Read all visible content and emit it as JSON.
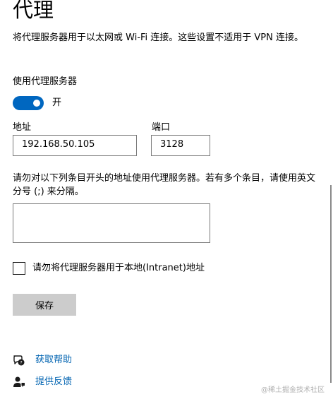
{
  "page": {
    "title": "代理",
    "description": "将代理服务器用于以太网或 Wi-Fi 连接。这些设置不适用于 VPN 连接。"
  },
  "proxy": {
    "use_proxy_label": "使用代理服务器",
    "toggle_state": "开",
    "toggle_on": true,
    "address_label": "地址",
    "address_value": "192.168.50.105",
    "port_label": "端口",
    "port_value": "3128",
    "exceptions_description": "请勿对以下列条目开头的地址使用代理服务器。若有多个条目，请使用英文分号 (;) 来分隔。",
    "exceptions_value": "",
    "local_bypass_label": "请勿将代理服务器用于本地(Intranet)地址",
    "local_bypass_checked": false,
    "save_label": "保存"
  },
  "links": {
    "help_label": "获取帮助",
    "help_icon": "chat-help-icon",
    "feedback_label": "提供反馈",
    "feedback_icon": "feedback-person-icon"
  },
  "watermark": "@稀土掘金技术社区",
  "colors": {
    "accent": "#0067c0",
    "link": "#0063b1",
    "button_bg": "#cccccc"
  }
}
